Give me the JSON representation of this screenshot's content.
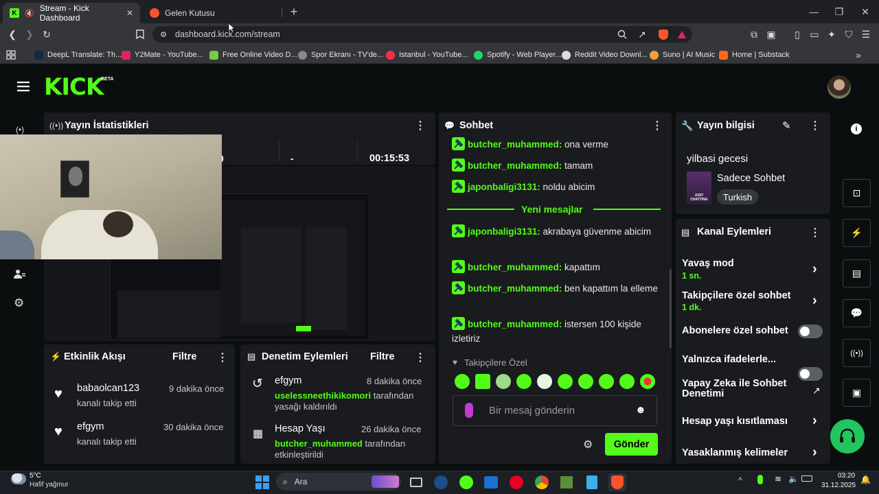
{
  "browser": {
    "tabs": [
      {
        "title": "Stream - Kick Dashboard",
        "active": true
      },
      {
        "title": "Gelen Kutusu",
        "active": false
      }
    ],
    "url": "dashboard.kick.com/stream",
    "bookmarks": [
      "DeepL Translate: Th...",
      "Y2Mate - YouTube...",
      "Free Online Video D...",
      "Spor Ekranı - TV'de...",
      "Istanbul - YouTube...",
      "Spotify - Web Player...",
      "Reddit Video Downl...",
      "Suno | AI Music",
      "Home | Substack"
    ]
  },
  "kick": {
    "logo": "KICK",
    "logo_badge": "BETA",
    "accent": "#53fc18"
  },
  "stats": {
    "title": "Yayın İstatistikleri",
    "value_partial": "0",
    "dash": "-",
    "duration": "00:15:53"
  },
  "activity": {
    "title": "Etkinlik Akışı",
    "filter": "Filtre",
    "items": [
      {
        "user": "babaolcan123",
        "action": "kanalı takip etti",
        "time": "9 dakika önce"
      },
      {
        "user": "efgym",
        "action": "kanalı takip etti",
        "time": "30 dakika önce"
      }
    ]
  },
  "moderation": {
    "title": "Denetim Eylemleri",
    "filter": "Filtre",
    "items": [
      {
        "title": "efgym",
        "time": "8 dakika önce",
        "user": "uselessneethikikomori",
        "rest": "tarafından",
        "line2": "yasağı kaldırıldı"
      },
      {
        "title": "Hesap Yaşı",
        "time": "26 dakika önce",
        "user": "butcher_muhammed",
        "rest": "tarafından",
        "line2": "etkinleştirildi"
      }
    ]
  },
  "chat": {
    "title": "Sohbet",
    "old_messages": [
      {
        "user": "butcher_muhammed:",
        "text": "ona verme"
      },
      {
        "user": "butcher_muhammed:",
        "text": "tamam"
      },
      {
        "user": "japonbaligi3131:",
        "text": "noldu abicim"
      }
    ],
    "divider": "Yeni mesajlar",
    "new_messages": [
      {
        "user": "japonbaligi3131:",
        "text": "akrabaya güvenme abicim"
      },
      {
        "user": "butcher_muhammed:",
        "text": "kapattım"
      },
      {
        "user": "butcher_muhammed:",
        "text": "ben kapattım la elleme"
      },
      {
        "user": "butcher_muhammed:",
        "text": "istersen 100 kişide izletiriz"
      }
    ],
    "followers_label": "Takipçilere Özel",
    "input_placeholder": "Bir mesaj gönderin",
    "send": "Gönder"
  },
  "stream_info": {
    "title": "Yayın bilgisi",
    "stream_title": "yilbasi gecesi",
    "category": "Sadece Sohbet",
    "thumb_text": "JUST CHATTING",
    "language": "Turkish"
  },
  "channel_actions": {
    "title": "Kanal Eylemleri",
    "items": [
      {
        "label": "Yavaş mod",
        "sub": "1 sn.",
        "control": "chevron"
      },
      {
        "label": "Takipçilere özel sohbet",
        "sub": "1 dk.",
        "control": "chevron"
      },
      {
        "label": "Abonelere özel sohbet",
        "sub": "",
        "control": "toggle"
      },
      {
        "label": "Yalnızca ifadelerle...",
        "sub": "",
        "control": "toggle"
      },
      {
        "label": "Yapay Zeka ile Sohbet Denetimi",
        "sub": "",
        "control": "external"
      },
      {
        "label": "Hesap yaşı kısıtlaması",
        "sub": "",
        "control": "chevron"
      },
      {
        "label": "Yasaklanmış kelimeler",
        "sub": "",
        "control": "chevron"
      }
    ]
  },
  "taskbar": {
    "weather_temp": "5°C",
    "weather_desc": "Hafif yağmur",
    "search": "Ara",
    "time": "03:20",
    "date": "31.12.2025"
  }
}
